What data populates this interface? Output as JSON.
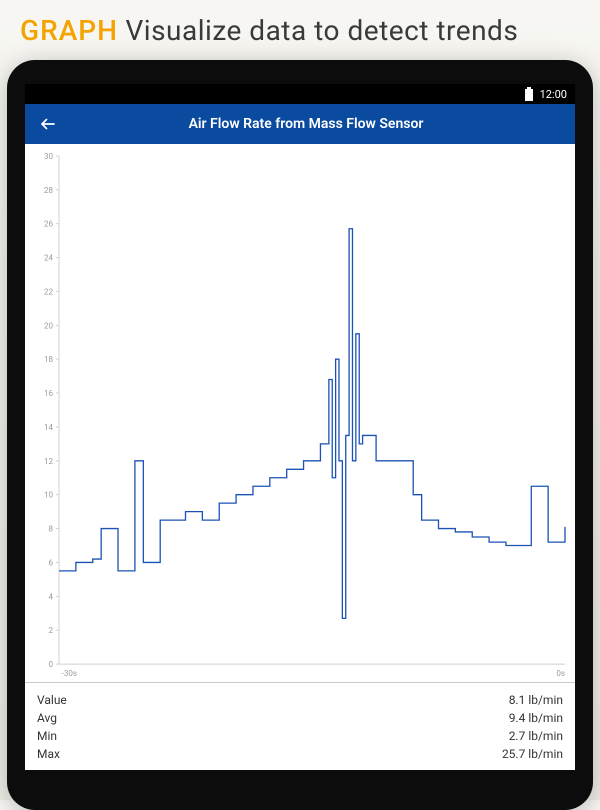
{
  "promo": {
    "accent": "GRAPH",
    "rest": " Visualize data to detect trends"
  },
  "statusbar": {
    "time": "12:00"
  },
  "appbar": {
    "title": "Air Flow Rate from Mass Flow Sensor"
  },
  "chart_data": {
    "type": "line",
    "title": "Air Flow Rate from Mass Flow Sensor",
    "ylabel": "lb/min",
    "xlabel": "s",
    "ylim": [
      0,
      30
    ],
    "yticks": [
      0,
      2,
      4,
      6,
      8,
      10,
      12,
      14,
      16,
      18,
      20,
      22,
      24,
      26,
      28,
      30
    ],
    "xlim": [
      -30,
      0
    ],
    "xticks_visible": [
      "-30s",
      "0s"
    ],
    "x": [
      -30,
      -29.5,
      -29,
      -28.5,
      -28,
      -27.5,
      -27,
      -26.5,
      -26,
      -25.5,
      -25,
      -24.5,
      -24,
      -23.5,
      -23,
      -22.5,
      -22,
      -21.5,
      -21,
      -20.5,
      -20,
      -19.5,
      -19,
      -18.5,
      -18,
      -17.5,
      -17,
      -16.5,
      -16,
      -15.5,
      -15,
      -14.5,
      -14,
      -13.8,
      -13.6,
      -13.4,
      -13.2,
      -13,
      -12.8,
      -12.6,
      -12.4,
      -12.2,
      -12,
      -11.8,
      -11.6,
      -11.4,
      -11.2,
      -11,
      -10.5,
      -10,
      -9.5,
      -9,
      -8.5,
      -8,
      -7.5,
      -7,
      -6.5,
      -6,
      -5.5,
      -5,
      -4.5,
      -4,
      -3.5,
      -3,
      -2.5,
      -2,
      -1.5,
      -1,
      -0.5,
      0
    ],
    "values": [
      5.5,
      5.5,
      6.0,
      6.0,
      6.2,
      8.0,
      8.0,
      5.5,
      5.5,
      12.0,
      6.0,
      6.0,
      8.5,
      8.5,
      8.5,
      9.0,
      9.0,
      8.5,
      8.5,
      9.5,
      9.5,
      10.0,
      10.0,
      10.5,
      10.5,
      11.0,
      11.0,
      11.5,
      11.5,
      12.0,
      12.0,
      13.0,
      16.8,
      11.0,
      18.0,
      12.0,
      2.7,
      13.5,
      25.7,
      12.0,
      19.5,
      13.0,
      13.5,
      13.5,
      13.5,
      13.5,
      12.0,
      12.0,
      12.0,
      12.0,
      12.0,
      10.0,
      8.5,
      8.5,
      8.0,
      8.0,
      7.8,
      7.8,
      7.5,
      7.5,
      7.2,
      7.2,
      7.0,
      7.0,
      7.0,
      10.5,
      10.5,
      7.2,
      7.2,
      8.1
    ]
  },
  "stats": {
    "rows": [
      {
        "label": "Value",
        "value": "8.1 lb/min"
      },
      {
        "label": "Avg",
        "value": "9.4 lb/min"
      },
      {
        "label": "Min",
        "value": "2.7 lb/min"
      },
      {
        "label": "Max",
        "value": "25.7 lb/min"
      }
    ]
  },
  "colors": {
    "accent": "#0a4ba0",
    "line": "#1b52b5",
    "promo_accent": "#f5a300"
  }
}
